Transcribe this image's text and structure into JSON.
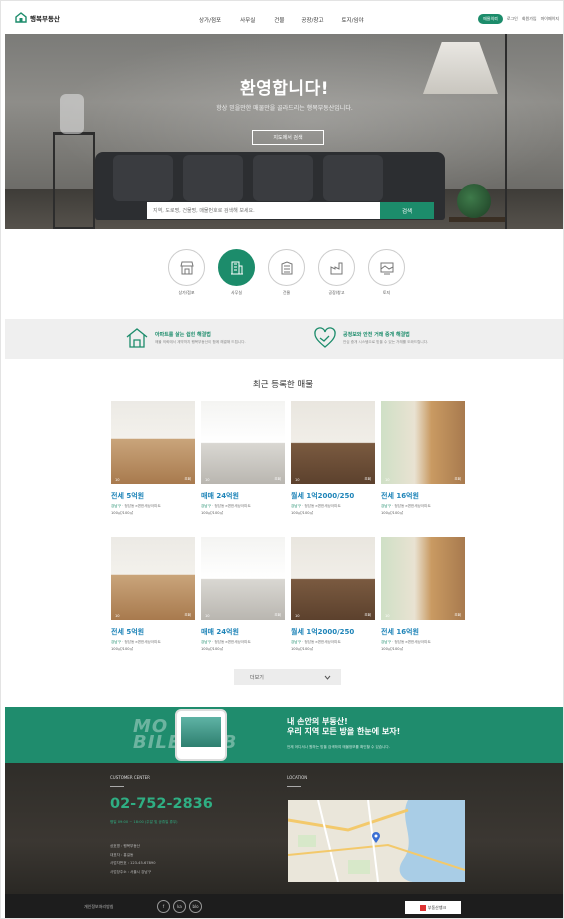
{
  "header": {
    "logo_text": "행복부동산",
    "nav": [
      "상가/점포",
      "사무실",
      "건물",
      "공장/창고",
      "토지/임야"
    ],
    "request_label": "매물의뢰",
    "util_links": [
      "로그인",
      "회원가입",
      "마이페이지"
    ]
  },
  "hero": {
    "title": "환영합니다!",
    "subtitle": "항상 믿을만한 매물만을 골라드리는 행복부동산입니다.",
    "map_search_label": "지도에서 검색",
    "search_placeholder": "지역, 도로명, 건물명, 매물번호로 검색해 보세요.",
    "search_button": "검색"
  },
  "categories": [
    {
      "label": "상가/점포",
      "icon": "store-icon",
      "active": false
    },
    {
      "label": "사무실",
      "icon": "office-icon",
      "active": true
    },
    {
      "label": "건물",
      "icon": "building-icon",
      "active": false
    },
    {
      "label": "공장/창고",
      "icon": "factory-icon",
      "active": false
    },
    {
      "label": "토지",
      "icon": "land-icon",
      "active": false
    }
  ],
  "banners": [
    {
      "title": "아파트를 살는 쉽힌 해결법",
      "desc": "매물 의뢰에서 계약까지 행복부동산이 함께 해결해 드립니다.",
      "icon": "house-icon"
    },
    {
      "title": "공정보와 안전 거래 중개 해결법",
      "desc": "안심 중개 시스템으로 믿을 수 있는 거래를 도와드립니다.",
      "icon": "handshake-icon"
    }
  ],
  "recent": {
    "title": "최근 등록한 매물",
    "listings": [
      {
        "price": "전세 5억원",
        "addr_tag": "강남구",
        "addr": "청담동 e편한세상아파트",
        "area": "100㎡/100㎡",
        "count": "10",
        "views": "조회"
      },
      {
        "price": "매매 24억원",
        "addr_tag": "강남구",
        "addr": "청담동 e편한세상아파트",
        "area": "100㎡/100㎡",
        "count": "10",
        "views": "조회"
      },
      {
        "price": "월세 1억2000/250",
        "addr_tag": "강남구",
        "addr": "청담동 e편한세상아파트",
        "area": "100㎡/100㎡",
        "count": "10",
        "views": "조회"
      },
      {
        "price": "전세 16억원",
        "addr_tag": "강남구",
        "addr": "청담동 e편한세상아파트",
        "area": "100㎡/100㎡",
        "count": "10",
        "views": "조회"
      },
      {
        "price": "전세 5억원",
        "addr_tag": "강남구",
        "addr": "청담동 e편한세상아파트",
        "area": "100㎡/100㎡",
        "count": "10",
        "views": "조회"
      },
      {
        "price": "매매 24억원",
        "addr_tag": "강남구",
        "addr": "청담동 e편한세상아파트",
        "area": "100㎡/100㎡",
        "count": "10",
        "views": "조회"
      },
      {
        "price": "월세 1억2000/250",
        "addr_tag": "강남구",
        "addr": "청담동 e편한세상아파트",
        "area": "100㎡/100㎡",
        "count": "10",
        "views": "조회"
      },
      {
        "price": "전세 16억원",
        "addr_tag": "강남구",
        "addr": "청담동 e편한세상아파트",
        "area": "100㎡/100㎡",
        "count": "10",
        "views": "조회"
      }
    ],
    "more_label": "더보기"
  },
  "mobile": {
    "watermark_line1": "MO",
    "watermark_line2": "BILE  WEB",
    "headline1": "내 손안의 부동산!",
    "headline2": "우리 지역 모든 방을 한눈에 보자!",
    "desc": "언제 어디서나 원하는 방을 검색하여 매물정보를 확인할 수 있습니다."
  },
  "footer": {
    "customer_title": "CUSTOMER CENTER",
    "phone": "02-752-2836",
    "hours": "평일 09:00 ~ 18:00 (주말 및 공휴일 휴무)",
    "info": [
      "상호명 : 행복부동산",
      "대표자 : 홍길동",
      "사업자번호 : 123-45-67890",
      "사업장주소 : 서울시 강남구"
    ],
    "location_title": "LOCATION",
    "privacy": "개인정보처리방침",
    "socials": [
      "f",
      "ka",
      "blo"
    ],
    "partner": "부동산뱅크"
  },
  "colors": {
    "brand": "#1c8c6b",
    "price": "#1e84b8"
  }
}
